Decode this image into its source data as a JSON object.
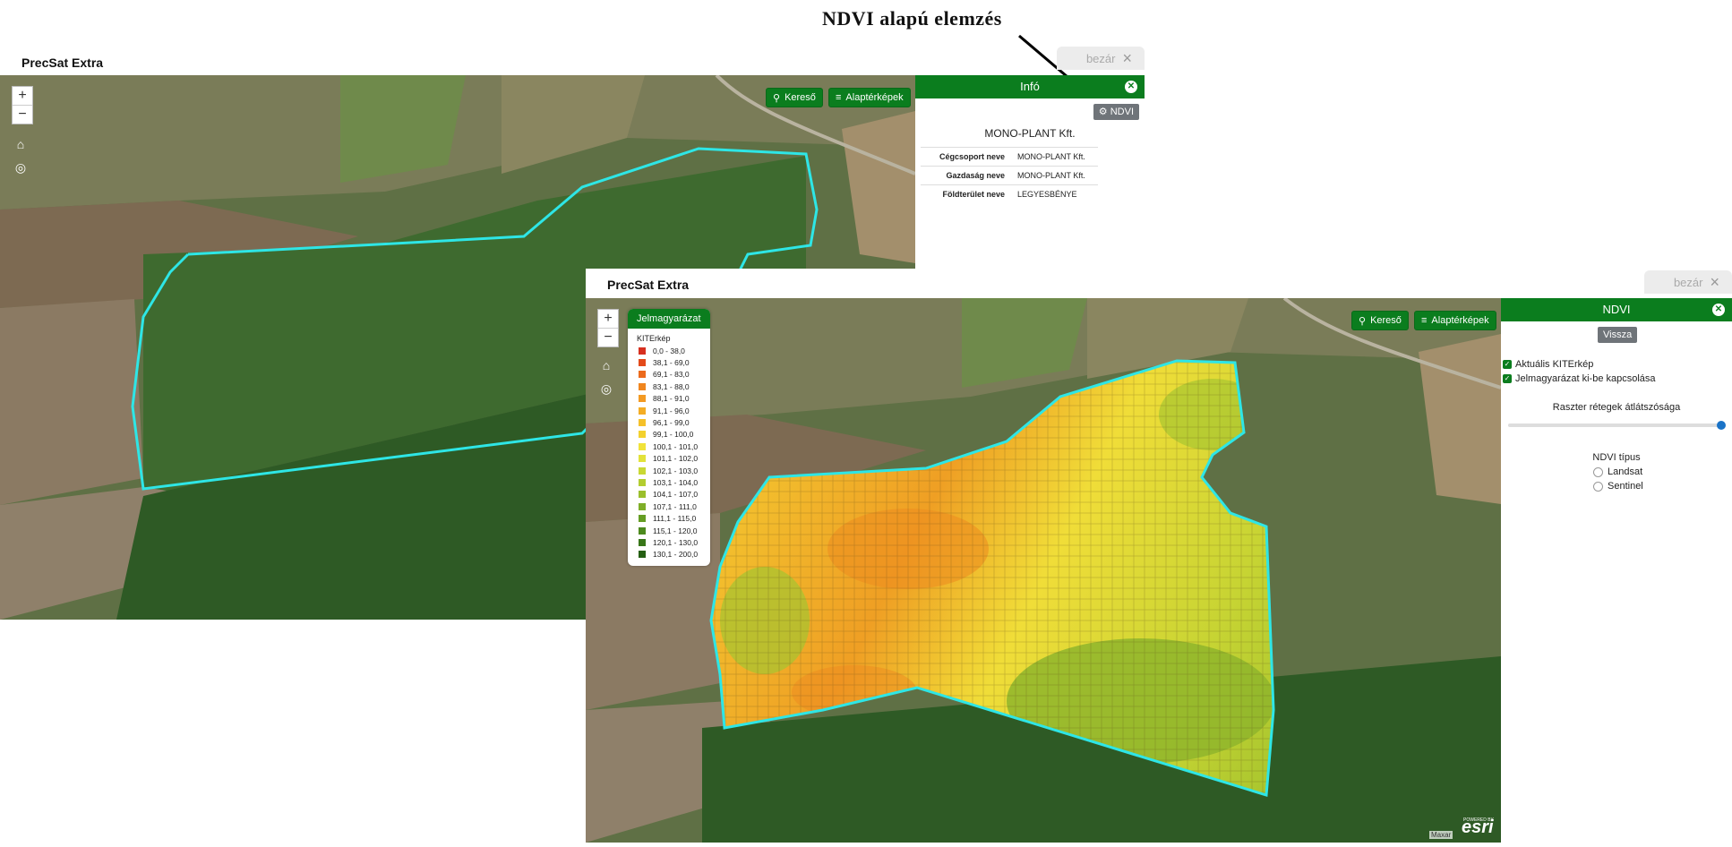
{
  "annotation": {
    "caption": "NDVI alapú elemzés"
  },
  "app": {
    "title": "PrecSat Extra",
    "close_label": "bezár",
    "close_icon": "×"
  },
  "map_controls": {
    "zoom_in": "+",
    "zoom_out": "−"
  },
  "toolbar": {
    "search_label": "Kereső",
    "basemaps_label": "Alaptérképek"
  },
  "info_panel": {
    "title": "Infó",
    "ndvi_button": "NDVI",
    "company": "MONO-PLANT Kft.",
    "rows": [
      {
        "key": "Cégcsoport neve",
        "value": "MONO-PLANT Kft."
      },
      {
        "key": "Gazdaság neve",
        "value": "MONO-PLANT Kft."
      },
      {
        "key": "Földterület neve",
        "value": "LEGYESBÉNYE"
      }
    ]
  },
  "legend": {
    "title": "Jelmagyarázat",
    "layer": "KITErkép",
    "items": [
      {
        "label": "0,0 - 38,0",
        "color": "#d7301f"
      },
      {
        "label": "38,1 - 69,0",
        "color": "#e34a1b"
      },
      {
        "label": "69,1 - 83,0",
        "color": "#ec6a1c"
      },
      {
        "label": "83,1 - 88,0",
        "color": "#f0861f"
      },
      {
        "label": "88,1 - 91,0",
        "color": "#f39a22"
      },
      {
        "label": "91,1 - 96,0",
        "color": "#f4ad24"
      },
      {
        "label": "96,1 - 99,0",
        "color": "#f5c12a"
      },
      {
        "label": "99,1 - 100,0",
        "color": "#f3d12e"
      },
      {
        "label": "100,1 - 101,0",
        "color": "#f1e33a"
      },
      {
        "label": "101,1 - 102,0",
        "color": "#e2e23a"
      },
      {
        "label": "102,1 - 103,0",
        "color": "#c9d834"
      },
      {
        "label": "103,1 - 104,0",
        "color": "#b3cd30"
      },
      {
        "label": "104,1 - 107,0",
        "color": "#9bbf2c"
      },
      {
        "label": "107,1 - 111,0",
        "color": "#7fae28"
      },
      {
        "label": "111,1 - 115,0",
        "color": "#659d23"
      },
      {
        "label": "115,1 - 120,0",
        "color": "#4d8a1e"
      },
      {
        "label": "120,1 - 130,0",
        "color": "#387619"
      },
      {
        "label": "130,1 - 200,0",
        "color": "#255f13"
      }
    ]
  },
  "ndvi_panel": {
    "title": "NDVI",
    "back_label": "Vissza",
    "options": [
      {
        "label": "Aktuális KITErkép",
        "checked": true
      },
      {
        "label": "Jelmagyarázat ki-be kapcsolása",
        "checked": true
      }
    ],
    "opacity_label": "Raszter rétegek átlátszósága",
    "opacity_value": 1.0,
    "type_label": "NDVI típus",
    "types": [
      "Landsat",
      "Sentinel"
    ]
  },
  "attribution": {
    "maxar": "Maxar",
    "powered": "POWERED BY",
    "esri": "esri"
  },
  "colors": {
    "accent": "#0b7d1e",
    "boundary": "#2ee6e6"
  },
  "icons": [
    "search-icon",
    "list-icon",
    "home-icon",
    "locate-icon",
    "gear-icon",
    "close-icon",
    "arrow-icon"
  ]
}
